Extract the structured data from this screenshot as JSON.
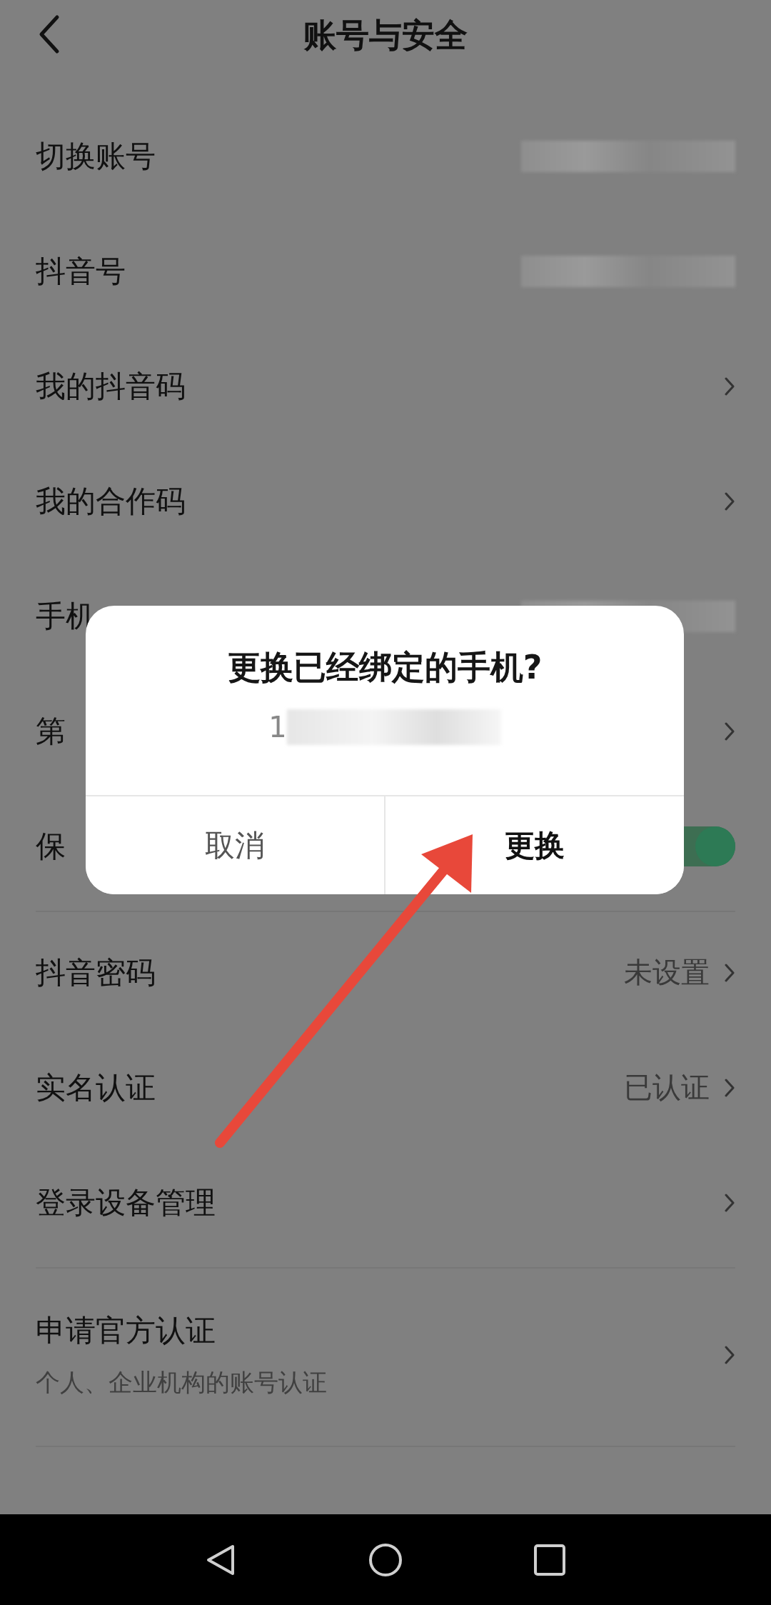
{
  "header": {
    "title": "账号与安全"
  },
  "groups": [
    {
      "rows": [
        {
          "kind": "link",
          "label": "切换账号",
          "redacted": true,
          "chevron": false
        },
        {
          "kind": "link",
          "label": "抖音号",
          "redacted": true,
          "chevron": false
        },
        {
          "kind": "link",
          "label": "我的抖音码",
          "chevron": true
        },
        {
          "kind": "link",
          "label": "我的合作码",
          "chevron": true
        },
        {
          "kind": "link",
          "label": "手机",
          "redacted": true,
          "chevron": false
        },
        {
          "kind": "link",
          "label": "第",
          "chevron": true
        },
        {
          "kind": "toggle",
          "label": "保",
          "on": true
        }
      ]
    },
    {
      "rows": [
        {
          "kind": "link",
          "label": "抖音密码",
          "value": "未设置",
          "chevron": true
        },
        {
          "kind": "link",
          "label": "实名认证",
          "value": "已认证",
          "chevron": true
        },
        {
          "kind": "link",
          "label": "登录设备管理",
          "chevron": true
        }
      ]
    },
    {
      "rows": [
        {
          "kind": "link",
          "label": "申请官方认证",
          "subtitle": "个人、企业机构的账号认证",
          "chevron": true
        }
      ]
    }
  ],
  "dialog": {
    "title": "更换已经绑定的手机?",
    "phone": "1",
    "phone_redacted": true,
    "buttons": [
      {
        "label": "取消",
        "primary": false
      },
      {
        "label": "更换",
        "primary": true
      }
    ]
  }
}
